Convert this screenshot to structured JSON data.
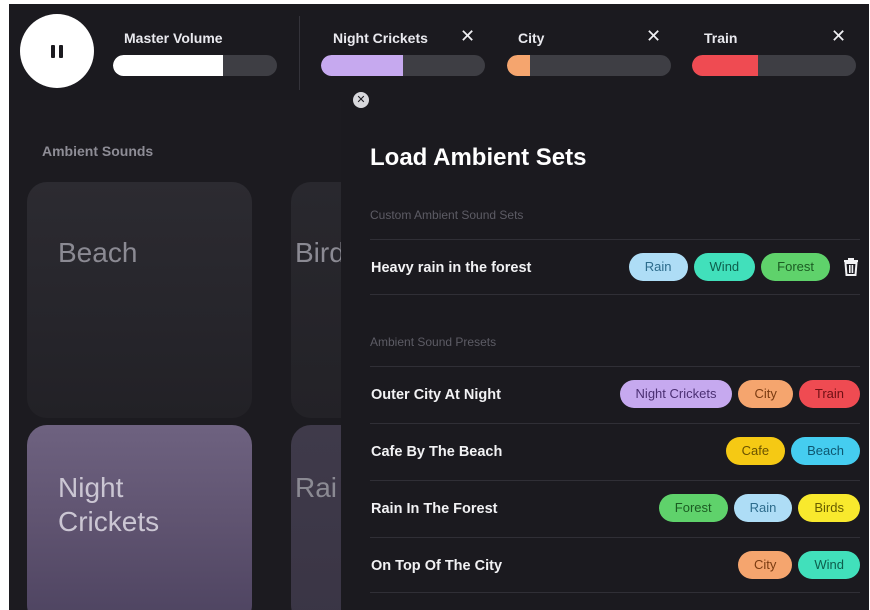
{
  "topbar": {
    "master": {
      "label": "Master Volume",
      "level": 0.67,
      "color": "#ffffff"
    },
    "mixers": [
      {
        "label": "Night Crickets",
        "level": 0.5,
        "color": "#c6a9ef"
      },
      {
        "label": "City",
        "level": 0.14,
        "color": "#f5a56e"
      },
      {
        "label": "Train",
        "level": 0.4,
        "color": "#ef4b52"
      }
    ],
    "close_glyph": "✕"
  },
  "background": {
    "heading": "Ambient Sounds",
    "cards": [
      "Beach",
      "Bird",
      "Night Crickets",
      "Rai"
    ]
  },
  "panel": {
    "close_glyph": "✕",
    "title": "Load Ambient Sets",
    "custom_label": "Custom Ambient Sound Sets",
    "presets_label": "Ambient Sound Presets",
    "custom_sets": [
      {
        "name": "Heavy rain in the forest",
        "tags": [
          "Rain",
          "Wind",
          "Forest"
        ]
      }
    ],
    "presets": [
      {
        "name": "Outer City At Night",
        "tags": [
          "Night Crickets",
          "City",
          "Train"
        ]
      },
      {
        "name": "Cafe By The Beach",
        "tags": [
          "Cafe",
          "Beach"
        ]
      },
      {
        "name": "Rain In The Forest",
        "tags": [
          "Forest",
          "Rain",
          "Birds"
        ]
      },
      {
        "name": "On Top Of The City",
        "tags": [
          "City",
          "Wind"
        ]
      }
    ]
  },
  "tag_colors": {
    "Rain": {
      "bg": "#aeddf6",
      "fg": "#2d6c8c"
    },
    "Wind": {
      "bg": "#41e0bb",
      "fg": "#0e5e4c"
    },
    "Forest": {
      "bg": "#5fd26b",
      "fg": "#1b5b22"
    },
    "Night Crickets": {
      "bg": "#c6a9ef",
      "fg": "#4b2f73"
    },
    "City": {
      "bg": "#f5a56e",
      "fg": "#7a3c12"
    },
    "Train": {
      "bg": "#ef4b52",
      "fg": "#6e1014"
    },
    "Cafe": {
      "bg": "#f5c914",
      "fg": "#6a5200"
    },
    "Beach": {
      "bg": "#45cdf0",
      "fg": "#0e5670"
    },
    "Birds": {
      "bg": "#f8e92d",
      "fg": "#665c00"
    }
  },
  "icons": {
    "pause": "pause-icon",
    "trash": "trash-icon",
    "close": "close-icon"
  }
}
